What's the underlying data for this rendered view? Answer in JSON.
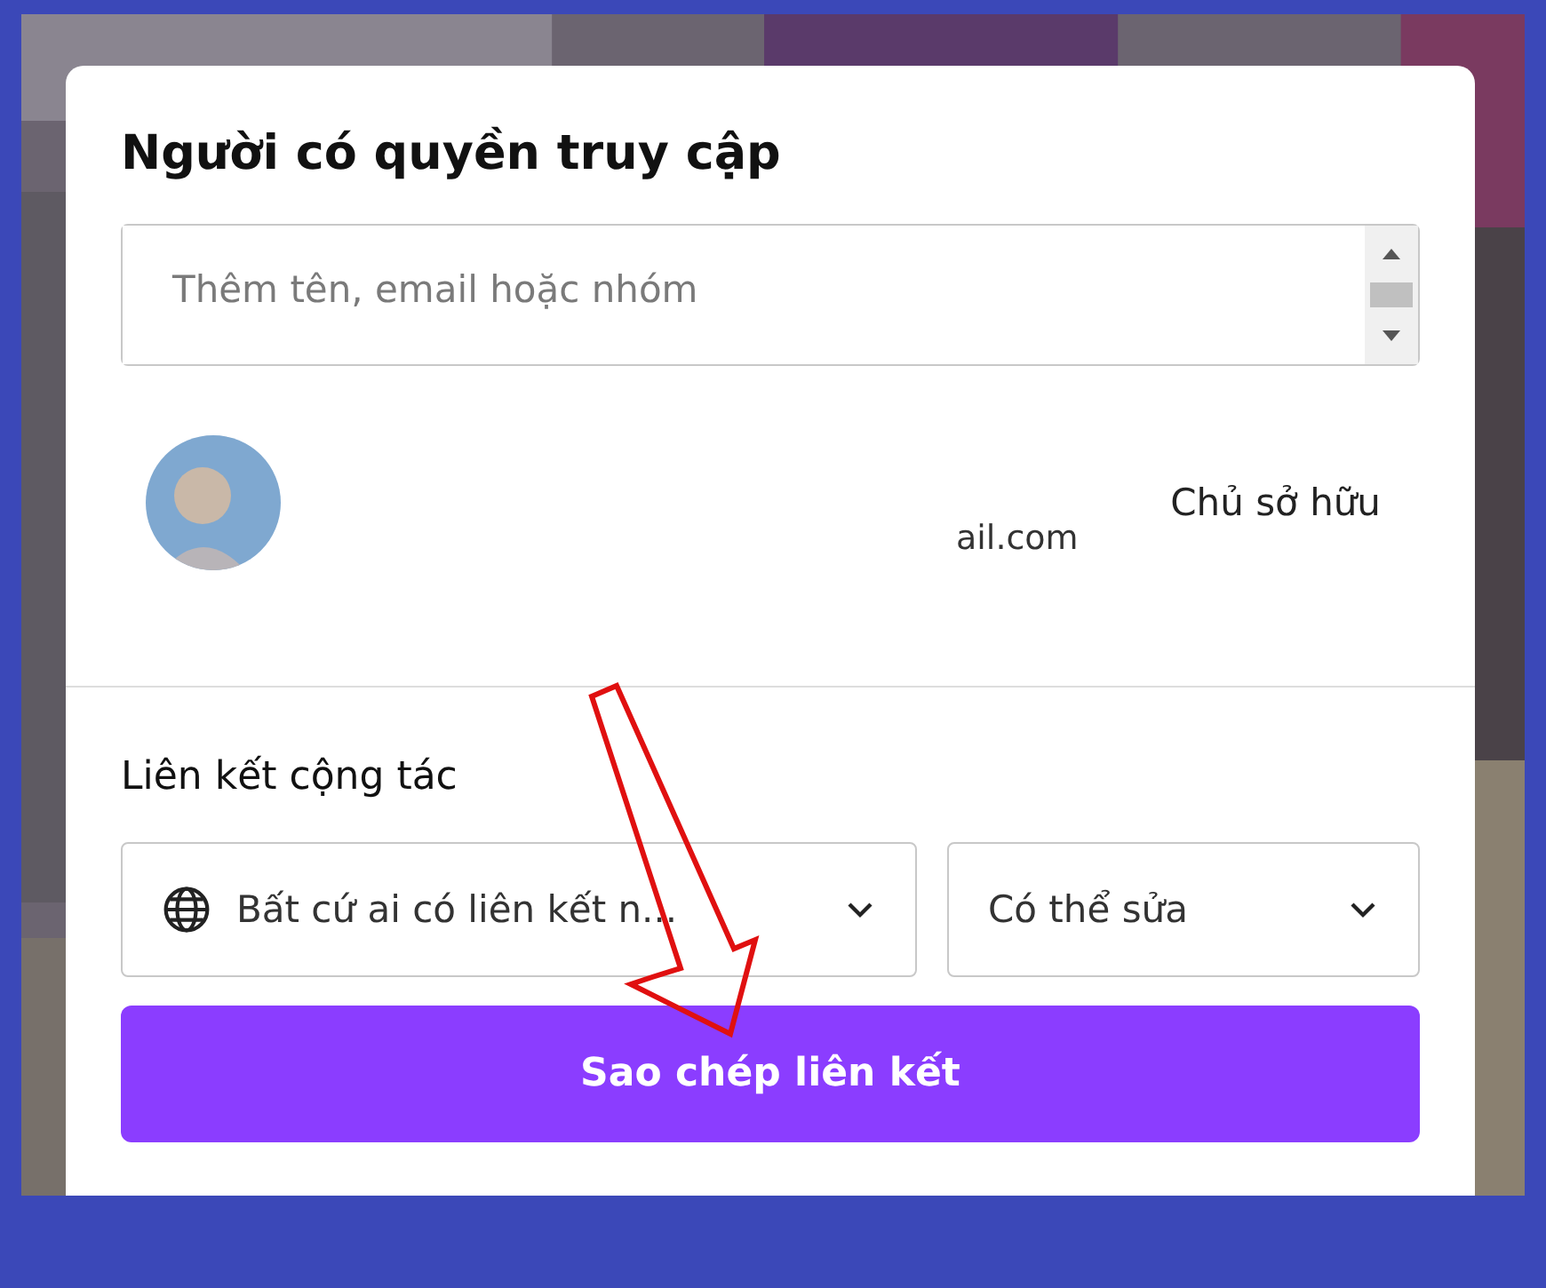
{
  "dialog": {
    "title": "Người có quyền truy cập",
    "search": {
      "placeholder": "Thêm tên, email hoặc nhóm"
    },
    "members": [
      {
        "email": "ail.com",
        "role": "Chủ sở hữu"
      }
    ],
    "link_section": {
      "title": "Liên kết cộng tác",
      "access": {
        "value": "Bất cứ ai có liên kết n..."
      },
      "permission": {
        "value": "Có thể sửa"
      },
      "copy_button": "Sao chép liên kết"
    }
  }
}
